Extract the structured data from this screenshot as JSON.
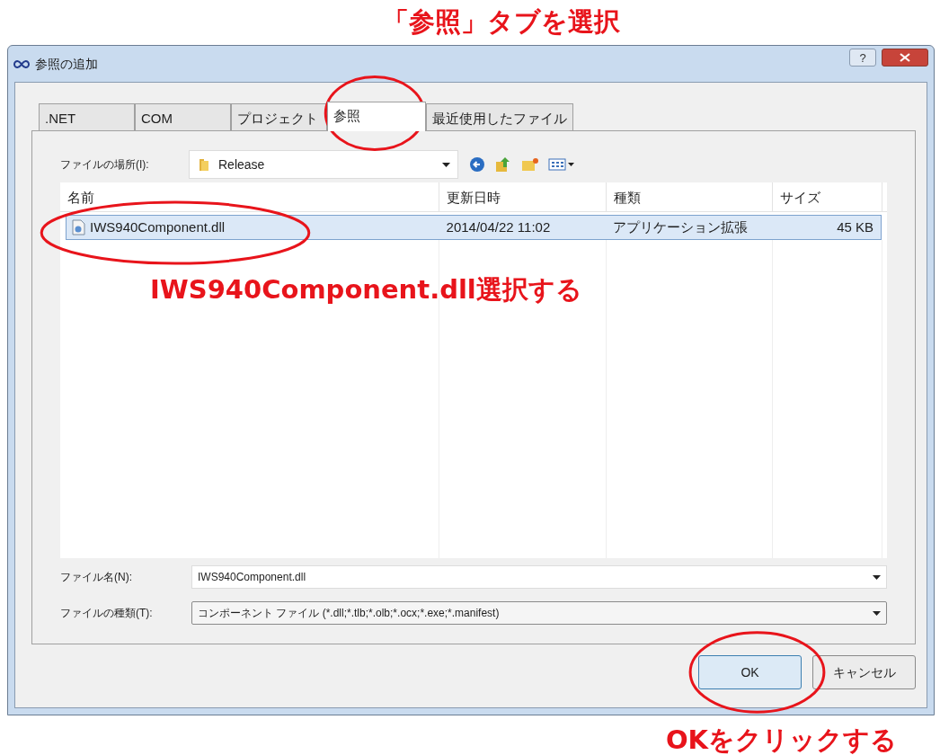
{
  "annotations": {
    "top": "「参照」タブを選択",
    "middle": "IWS940Component.dll選択する",
    "bottom": "OKをクリックする"
  },
  "window": {
    "title": "参照の追加",
    "help_button": "?"
  },
  "tabs": [
    {
      "label": ".NET",
      "selected": false
    },
    {
      "label": "COM",
      "selected": false
    },
    {
      "label": "プロジェクト",
      "selected": false
    },
    {
      "label": "参照",
      "selected": true
    },
    {
      "label": "最近使用したファイル",
      "selected": false
    }
  ],
  "location": {
    "label": "ファイルの場所(I):",
    "value": "Release"
  },
  "table": {
    "columns": [
      "名前",
      "更新日時",
      "種類",
      "サイズ"
    ],
    "rows": [
      {
        "cells": [
          "IWS940Component.dll",
          "2014/04/22 11:02",
          "アプリケーション拡張",
          "45 KB"
        ],
        "selected": true
      }
    ]
  },
  "filename": {
    "label": "ファイル名(N):",
    "value": "IWS940Component.dll"
  },
  "filetype": {
    "label": "ファイルの種類(T):",
    "value": "コンポーネント ファイル (*.dll;*.tlb;*.olb;*.ocx;*.exe;*.manifest)"
  },
  "buttons": [
    {
      "label": "OK",
      "kind": "default"
    },
    {
      "label": "キャンセル",
      "kind": "normal"
    }
  ]
}
